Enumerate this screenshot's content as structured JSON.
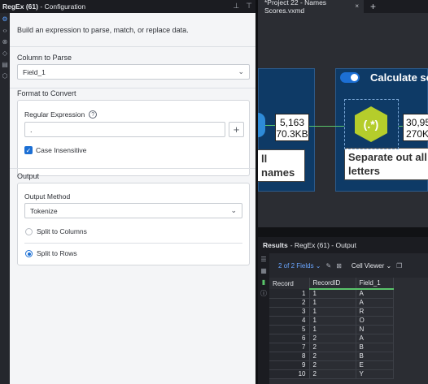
{
  "config_header": {
    "tool": "RegEx (61)",
    "title": "- Configuration",
    "icons": [
      "pin-icon",
      "dock-icon"
    ]
  },
  "config": {
    "description": "Build an expression to parse, match, or replace data.",
    "column_to_parse_label": "Column to Parse",
    "column_to_parse_value": "Field_1",
    "format_label": "Format to Convert",
    "regex_label": "Regular Expression",
    "regex_value": ".",
    "case_insensitive_label": "Case Insensitive",
    "case_insensitive_checked": true,
    "output_label": "Output",
    "output_method_label": "Output Method",
    "output_method_value": "Tokenize",
    "option_split_columns": "Split to Columns",
    "option_split_rows": "Split to Rows",
    "selected_option": "Split to Rows"
  },
  "sidebar_icons": [
    "settings-icon",
    "code-icon",
    "x-circle-icon",
    "tag-icon",
    "layers-icon",
    "cube-icon"
  ],
  "tab": {
    "label": "*Project 22 - Names Scores.yxmd",
    "close": "×",
    "plus": "+"
  },
  "canvas": {
    "node1_line1": "5,163",
    "node1_line2": "70.3KB",
    "node1_caption": "ll names",
    "container_title": "Calculate sc",
    "regex_symbol": "(.*)",
    "regex_caption_line1": "Separate out all",
    "regex_caption_line2": "letters",
    "node2_line1": "30,95",
    "node2_line2": "270K"
  },
  "results": {
    "title": "Results",
    "subtitle": "- RegEx (61) - Output",
    "fields_label": "2 of 2 Fields",
    "cell_viewer_label": "Cell Viewer",
    "columns": [
      "Record",
      "RecordID",
      "Field_1"
    ],
    "rows": [
      [
        "1",
        "1",
        "A"
      ],
      [
        "2",
        "1",
        "A"
      ],
      [
        "3",
        "1",
        "R"
      ],
      [
        "4",
        "1",
        "O"
      ],
      [
        "5",
        "1",
        "N"
      ],
      [
        "6",
        "2",
        "A"
      ],
      [
        "7",
        "2",
        "B"
      ],
      [
        "8",
        "2",
        "B"
      ],
      [
        "9",
        "2",
        "E"
      ],
      [
        "10",
        "2",
        "Y"
      ]
    ]
  },
  "colors": {
    "accent": "#1c6fd4",
    "container": "#0e3a66",
    "regex_tool": "#b5cd2b",
    "column_highlight": "#59c46a"
  }
}
